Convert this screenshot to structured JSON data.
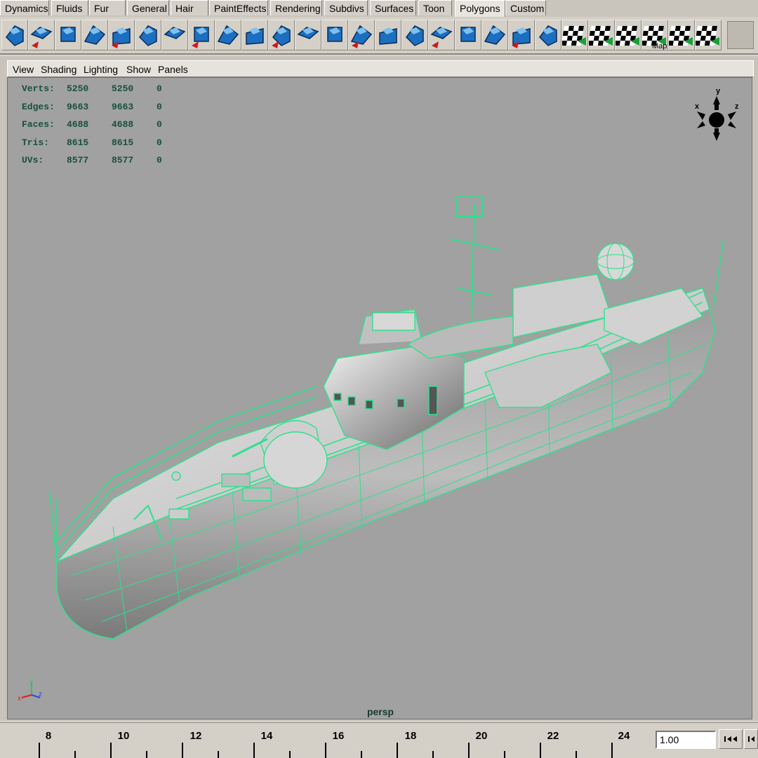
{
  "shelf_tabs": [
    {
      "label": "Dynamics",
      "active": false
    },
    {
      "label": "Fluids",
      "active": false
    },
    {
      "label": "Fur",
      "active": false
    },
    {
      "label": "General",
      "active": false
    },
    {
      "label": "Hair",
      "active": false
    },
    {
      "label": "PaintEffects",
      "active": false
    },
    {
      "label": "Rendering",
      "active": false
    },
    {
      "label": "Subdivs",
      "active": false
    },
    {
      "label": "Surfaces",
      "active": false
    },
    {
      "label": "Toon",
      "active": false
    },
    {
      "label": "Polygons",
      "active": true
    },
    {
      "label": "Custom",
      "active": false
    }
  ],
  "shelf_icons": [
    "polygon-sphere-tool-icon",
    "combine-icon",
    "separate-icon",
    "extract-icon",
    "booleans-icon",
    "cube-wireframe-icon",
    "smooth-icon",
    "triangulate-icon",
    "quadrangulate-icon",
    "extrude-face-icon",
    "extrude-edge-icon",
    "bridge-icon",
    "append-polygon-icon",
    "split-polygon-icon",
    "wedge-faces-icon",
    "poke-faces-icon",
    "duplicate-face-icon",
    "collapse-icon",
    "merge-vertices-icon",
    "soften-edge-icon",
    "sculpt-tool-icon",
    "planar-mapping-icon",
    "cylindrical-mapping-icon",
    "spherical-mapping-icon",
    "automatic-mapping-icon",
    "uv-layout-icon",
    "uv-texture-editor-icon"
  ],
  "shelf_icon_text": {
    "map_label": "Map"
  },
  "panel_menu": [
    "View",
    "Shading",
    "Lighting",
    "Show",
    "Panels"
  ],
  "hud": {
    "rows": [
      {
        "label": "Verts:",
        "object": "5250",
        "selected": "5250",
        "components": "0"
      },
      {
        "label": "Edges:",
        "object": "9663",
        "selected": "9663",
        "components": "0"
      },
      {
        "label": "Faces:",
        "object": "4688",
        "selected": "4688",
        "components": "0"
      },
      {
        "label": "Tris:",
        "object": "8615",
        "selected": "8615",
        "components": "0"
      },
      {
        "label": "UVs:",
        "object": "8577",
        "selected": "8577",
        "components": "0"
      }
    ]
  },
  "view_cube": {
    "x": "x",
    "y": "y",
    "z": "z"
  },
  "axis_gizmo": {
    "x": "x",
    "y": "y",
    "z": "z"
  },
  "camera_label": "persp",
  "colors": {
    "wireframe": "#2fe08e",
    "viewport_bg": "#a1a1a1",
    "hud_text": "#17503a"
  },
  "time_slider": {
    "ticks": [
      "8",
      "10",
      "12",
      "14",
      "16",
      "18",
      "20",
      "22",
      "24"
    ],
    "current_frame": "1.00"
  },
  "playback_icons": [
    "go-to-start-icon",
    "step-back-icon"
  ]
}
